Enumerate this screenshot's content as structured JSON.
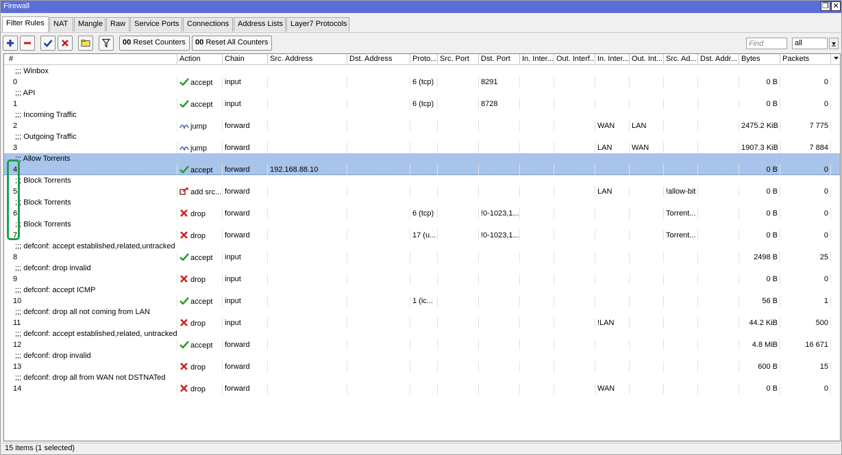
{
  "window": {
    "title": "Firewall"
  },
  "tabs": [
    "Filter Rules",
    "NAT",
    "Mangle",
    "Raw",
    "Service Ports",
    "Connections",
    "Address Lists",
    "Layer7 Protocols"
  ],
  "toolbar": {
    "reset_counters": "Reset Counters",
    "reset_all_counters": "Reset All Counters",
    "oo": "00",
    "find_placeholder": "Find",
    "filter_value": "all"
  },
  "columns": [
    "#",
    "Action",
    "Chain",
    "Src. Address",
    "Dst. Address",
    "Proto...",
    "Src. Port",
    "Dst. Port",
    "In. Inter...",
    "Out. Interf...",
    "In. Inter...",
    "Out. Int...",
    "Src. Ad...",
    "Dst. Addr...",
    "Bytes",
    "Packets"
  ],
  "rows": [
    {
      "comment": ";;; Winbox",
      "num": "0",
      "action": "accept",
      "icon": "check-icon",
      "chain": "input",
      "src": "",
      "proto": "6 (tcp)",
      "dport": "8291",
      "inl": "",
      "outl": "",
      "srcl": "",
      "bytes": "0 B",
      "packets": "0"
    },
    {
      "comment": ";;; API",
      "num": "1",
      "action": "accept",
      "icon": "check-icon",
      "chain": "input",
      "src": "",
      "proto": "6 (tcp)",
      "dport": "8728",
      "inl": "",
      "outl": "",
      "srcl": "",
      "bytes": "0 B",
      "packets": "0"
    },
    {
      "comment": ";;; Incoming Traffic",
      "num": "2",
      "action": "jump",
      "icon": "jump-icon",
      "chain": "forward",
      "src": "",
      "proto": "",
      "dport": "",
      "inl": "WAN",
      "outl": "LAN",
      "srcl": "",
      "bytes": "2475.2 KiB",
      "packets": "7 775"
    },
    {
      "comment": ";;; Outgoing Traffic",
      "num": "3",
      "action": "jump",
      "icon": "jump-icon",
      "chain": "forward",
      "src": "",
      "proto": "",
      "dport": "",
      "inl": "LAN",
      "outl": "WAN",
      "srcl": "",
      "bytes": "1907.3 KiB",
      "packets": "7 884"
    },
    {
      "comment": ";;; Allow Torrents",
      "num": "4",
      "action": "accept",
      "icon": "check-icon",
      "chain": "forward",
      "src": "192.168.88.10",
      "proto": "",
      "dport": "",
      "inl": "",
      "outl": "",
      "srcl": "",
      "bytes": "0 B",
      "packets": "0",
      "selected": true
    },
    {
      "comment": ";;; Block Torrents",
      "num": "5",
      "action": "add src...",
      "icon": "add-src-icon",
      "chain": "forward",
      "src": "",
      "proto": "",
      "dport": "",
      "inl": "LAN",
      "outl": "",
      "srcl": "!allow-bit",
      "bytes": "0 B",
      "packets": "0"
    },
    {
      "comment": ";;; Block Torrents",
      "num": "6",
      "action": "drop",
      "icon": "x-icon",
      "chain": "forward",
      "src": "",
      "proto": "6 (tcp)",
      "dport": "!0-1023,1...",
      "inl": "",
      "outl": "",
      "srcl": "Torrent...",
      "bytes": "0 B",
      "packets": "0"
    },
    {
      "comment": ";;; Block Torrents",
      "num": "7",
      "action": "drop",
      "icon": "x-icon",
      "chain": "forward",
      "src": "",
      "proto": "17 (u...",
      "dport": "!0-1023,1...",
      "inl": "",
      "outl": "",
      "srcl": "Torrent...",
      "bytes": "0 B",
      "packets": "0"
    },
    {
      "comment": ";;; defconf: accept established,related,untracked",
      "num": "8",
      "action": "accept",
      "icon": "check-icon",
      "chain": "input",
      "src": "",
      "proto": "",
      "dport": "",
      "inl": "",
      "outl": "",
      "srcl": "",
      "bytes": "2498 B",
      "packets": "25"
    },
    {
      "comment": ";;; defconf: drop invalid",
      "num": "9",
      "action": "drop",
      "icon": "x-icon",
      "chain": "input",
      "src": "",
      "proto": "",
      "dport": "",
      "inl": "",
      "outl": "",
      "srcl": "",
      "bytes": "0 B",
      "packets": "0"
    },
    {
      "comment": ";;; defconf: accept ICMP",
      "num": "10",
      "action": "accept",
      "icon": "check-icon",
      "chain": "input",
      "src": "",
      "proto": "1 (ic...",
      "dport": "",
      "inl": "",
      "outl": "",
      "srcl": "",
      "bytes": "56 B",
      "packets": "1"
    },
    {
      "comment": ";;; defconf: drop all not coming from LAN",
      "num": "11",
      "action": "drop",
      "icon": "x-icon",
      "chain": "input",
      "src": "",
      "proto": "",
      "dport": "",
      "inl": "!LAN",
      "outl": "",
      "srcl": "",
      "bytes": "44.2 KiB",
      "packets": "500"
    },
    {
      "comment": ";;; defconf: accept established,related, untracked",
      "num": "12",
      "action": "accept",
      "icon": "check-icon",
      "chain": "forward",
      "src": "",
      "proto": "",
      "dport": "",
      "inl": "",
      "outl": "",
      "srcl": "",
      "bytes": "4.8 MiB",
      "packets": "16 671"
    },
    {
      "comment": ";;; defconf: drop invalid",
      "num": "13",
      "action": "drop",
      "icon": "x-icon",
      "chain": "forward",
      "src": "",
      "proto": "",
      "dport": "",
      "inl": "",
      "outl": "",
      "srcl": "",
      "bytes": "600 B",
      "packets": "15"
    },
    {
      "comment": ";;; defconf: drop all from WAN not DSTNATed",
      "num": "14",
      "action": "drop",
      "icon": "x-icon",
      "chain": "forward",
      "src": "",
      "proto": "",
      "dport": "",
      "inl": "WAN",
      "outl": "",
      "srcl": "",
      "bytes": "0 B",
      "packets": "0"
    }
  ],
  "status": {
    "text": "15 items (1 selected)"
  },
  "colors": {
    "title_bar": "#5a6fd6",
    "selection": "#a9c4eb",
    "accept": "#2a9d2a",
    "drop": "#d02020",
    "highlight": "#16a34a"
  }
}
